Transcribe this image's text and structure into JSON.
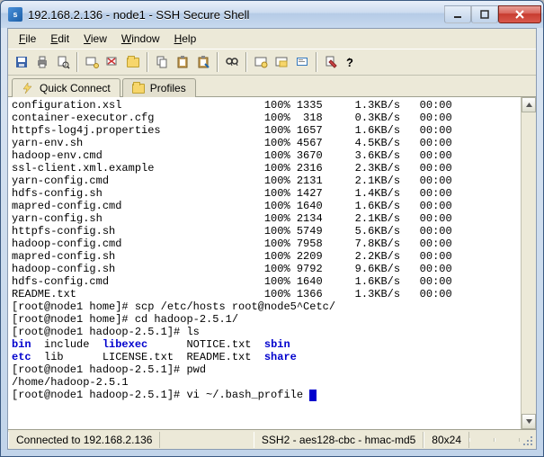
{
  "window": {
    "title": "192.168.2.136 - node1 - SSH Secure Shell"
  },
  "menus": {
    "file": "File",
    "edit": "Edit",
    "view": "View",
    "window": "Window",
    "help": "Help"
  },
  "tabs": {
    "quickconnect": "Quick Connect",
    "profiles": "Profiles"
  },
  "status": {
    "connected": "Connected to 192.168.2.136",
    "cipher": "SSH2 - aes128-cbc - hmac-md5",
    "size": "80x24"
  },
  "files": [
    {
      "name": "configuration.xsl",
      "pct": "100%",
      "size": "1335",
      "rate": "1.3KB/s",
      "time": "00:00"
    },
    {
      "name": "container-executor.cfg",
      "pct": "100%",
      "size": "318",
      "rate": "0.3KB/s",
      "time": "00:00"
    },
    {
      "name": "httpfs-log4j.properties",
      "pct": "100%",
      "size": "1657",
      "rate": "1.6KB/s",
      "time": "00:00"
    },
    {
      "name": "yarn-env.sh",
      "pct": "100%",
      "size": "4567",
      "rate": "4.5KB/s",
      "time": "00:00"
    },
    {
      "name": "hadoop-env.cmd",
      "pct": "100%",
      "size": "3670",
      "rate": "3.6KB/s",
      "time": "00:00"
    },
    {
      "name": "ssl-client.xml.example",
      "pct": "100%",
      "size": "2316",
      "rate": "2.3KB/s",
      "time": "00:00"
    },
    {
      "name": "yarn-config.cmd",
      "pct": "100%",
      "size": "2131",
      "rate": "2.1KB/s",
      "time": "00:00"
    },
    {
      "name": "hdfs-config.sh",
      "pct": "100%",
      "size": "1427",
      "rate": "1.4KB/s",
      "time": "00:00"
    },
    {
      "name": "mapred-config.cmd",
      "pct": "100%",
      "size": "1640",
      "rate": "1.6KB/s",
      "time": "00:00"
    },
    {
      "name": "yarn-config.sh",
      "pct": "100%",
      "size": "2134",
      "rate": "2.1KB/s",
      "time": "00:00"
    },
    {
      "name": "httpfs-config.sh",
      "pct": "100%",
      "size": "5749",
      "rate": "5.6KB/s",
      "time": "00:00"
    },
    {
      "name": "hadoop-config.cmd",
      "pct": "100%",
      "size": "7958",
      "rate": "7.8KB/s",
      "time": "00:00"
    },
    {
      "name": "mapred-config.sh",
      "pct": "100%",
      "size": "2209",
      "rate": "2.2KB/s",
      "time": "00:00"
    },
    {
      "name": "hadoop-config.sh",
      "pct": "100%",
      "size": "9792",
      "rate": "9.6KB/s",
      "time": "00:00"
    },
    {
      "name": "hdfs-config.cmd",
      "pct": "100%",
      "size": "1640",
      "rate": "1.6KB/s",
      "time": "00:00"
    },
    {
      "name": "README.txt",
      "pct": "100%",
      "size": "1366",
      "rate": "1.3KB/s",
      "time": "00:00"
    }
  ],
  "lines": {
    "l1p": "[root@node1 home]# ",
    "l1c": "scp /etc/hosts root@node5^Cetc/",
    "l2p": "[root@node1 home]# ",
    "l2c": "cd hadoop-2.5.1/",
    "l3p": "[root@node1 hadoop-2.5.1]# ",
    "l3c": "ls",
    "ls1a": "bin",
    "ls1b": "  include  ",
    "ls1c": "libexec",
    "ls1d": "      NOTICE.txt  ",
    "ls1e": "sbin",
    "ls2a": "etc",
    "ls2b": "  lib      LICENSE.txt  README.txt  ",
    "ls2c": "share",
    "l4p": "[root@node1 hadoop-2.5.1]# ",
    "l4c": "pwd",
    "pwd": "/home/hadoop-2.5.1",
    "l5p": "[root@node1 hadoop-2.5.1]# ",
    "l5c": "vi ~/.bash_profile "
  }
}
